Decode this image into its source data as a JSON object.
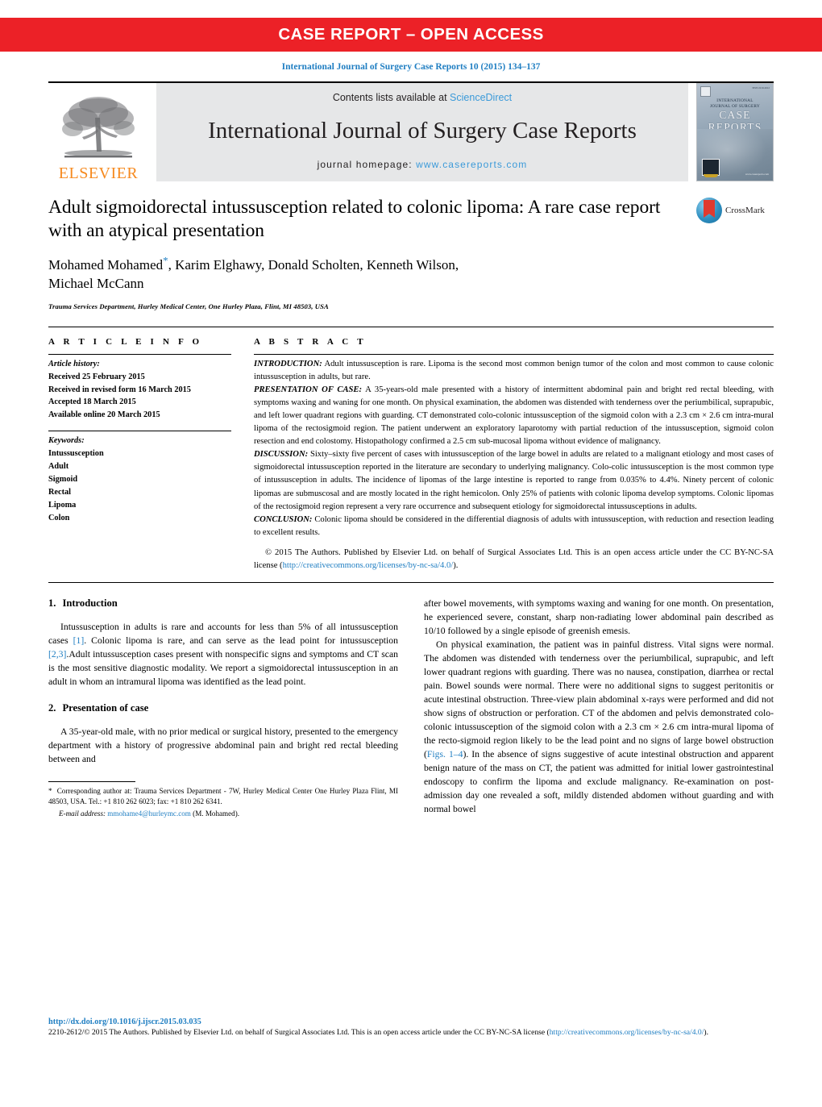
{
  "banner": {
    "text": "CASE REPORT – OPEN ACCESS"
  },
  "citation": "International Journal of Surgery Case Reports 10 (2015) 134–137",
  "masthead": {
    "publisher_logo_name": "elsevier-tree-logo",
    "publisher_wordmark": "ELSEVIER",
    "contents_prefix": "Contents lists available at ",
    "contents_link": "ScienceDirect",
    "journal_title": "International Journal of Surgery Case Reports",
    "homepage_prefix": "journal homepage: ",
    "homepage_url": "www.casereports.com",
    "cover": {
      "line1": "INTERNATIONAL",
      "line2": "JOURNAL OF SURGERY",
      "line3": "CASE",
      "line4": "REPORTS",
      "subtitle": "Advancing research for the better of patients",
      "issn_corner": "ISSN 2210-2612",
      "url": "www.casereports.com"
    }
  },
  "article": {
    "title": "Adult sigmoidorectal intussusception related to colonic lipoma: A rare case report with an atypical presentation",
    "authors": "Mohamed Mohamed, Karim Elghawy, Donald Scholten, Kenneth Wilson, Michael McCann",
    "author_marker": "*",
    "affiliation": "Trauma Services Department, Hurley Medical Center, One Hurley Plaza, Flint, MI 48503, USA",
    "crossmark_label": "CrossMark"
  },
  "article_info": {
    "label": "A R T I C L E   I N F O",
    "history_heading": "Article history:",
    "history": [
      "Received 25 February 2015",
      "Received in revised form 16 March 2015",
      "Accepted 18 March 2015",
      "Available online 20 March 2015"
    ],
    "keywords_heading": "Keywords:",
    "keywords": [
      "Intussusception",
      "Adult",
      "Sigmoid",
      "Rectal",
      "Lipoma",
      "Colon"
    ]
  },
  "abstract": {
    "label": "A B S T R A C T",
    "intro_label": "INTRODUCTION:",
    "intro_text": " Adult intussusception is rare. Lipoma is the second most common benign tumor of the colon and most common to cause colonic intussusception in adults, but rare.",
    "presentation_label": "PRESENTATION OF CASE:",
    "presentation_text": " A 35-years-old male presented with a history of intermittent abdominal pain and bright red rectal bleeding, with symptoms waxing and waning for one month. On physical examination, the abdomen was distended with tenderness over the periumbilical, suprapubic, and left lower quadrant regions with guarding. CT demonstrated colo-colonic intussusception of the sigmoid colon with a 2.3 cm × 2.6 cm intra-mural lipoma of the rectosigmoid region. The patient underwent an exploratory laparotomy with partial reduction of the intussusception, sigmoid colon resection and end colostomy. Histopathology confirmed a 2.5 cm sub-mucosal lipoma without evidence of malignancy.",
    "discussion_label": "DISCUSSION:",
    "discussion_text": " Sixty–sixty five percent of cases with intussusception of the large bowel in adults are related to a malignant etiology and most cases of sigmoidorectal intussusception reported in the literature are secondary to underlying malignancy. Colo-colic intussusception is the most common type of intussusception in adults. The incidence of lipomas of the large intestine is reported to range from 0.035% to 4.4%. Ninety percent of colonic lipomas are submuscosal and are mostly located in the right hemicolon. Only 25% of patients with colonic lipoma develop symptoms. Colonic lipomas of the rectosigmoid region represent a very rare occurrence and subsequent etiology for sigmoidorectal intussusceptions in adults.",
    "conclusion_label": "CONCLUSION:",
    "conclusion_text": " Colonic lipoma should be considered in the differential diagnosis of adults with intussusception, with reduction and resection leading to excellent results.",
    "copyright_text": "© 2015 The Authors. Published by Elsevier Ltd. on behalf of Surgical Associates Ltd. This is an open access article under the CC BY-NC-SA license (",
    "copyright_link": "http://creativecommons.org/licenses/by-nc-sa/4.0/",
    "copyright_tail": ")."
  },
  "body": {
    "section1_num": "1.",
    "section1_title": "Introduction",
    "section1_p1_a": "Intussusception in adults is rare and accounts for less than 5% of all intussusception cases ",
    "section1_ref1": "[1]",
    "section1_p1_b": ". Colonic lipoma is rare, and can serve as the lead point for intussusception ",
    "section1_ref2": "[2,3]",
    "section1_p1_c": ".Adult intussusception cases present with nonspecific signs and symptoms and CT scan is the most sensitive diagnostic modality. We report a sigmoidorectal intussusception in an adult in whom an intramural lipoma was identified as the lead point.",
    "section2_num": "2.",
    "section2_title": "Presentation of case",
    "section2_p1": "A 35-year-old male, with no prior medical or surgical history, presented to the emergency department with a history of progressive abdominal pain and bright red rectal bleeding between and",
    "right_p1": "after bowel movements, with symptoms waxing and waning for one month. On presentation, he experienced severe, constant, sharp non-radiating lower abdominal pain described as 10/10 followed by a single episode of greenish emesis.",
    "right_p2_a": "On physical examination, the patient was in painful distress. Vital signs were normal. The abdomen was distended with tenderness over the periumbilical, suprapubic, and left lower quadrant regions with guarding. There was no nausea, constipation, diarrhea or rectal pain. Bowel sounds were normal. There were no additional signs to suggest peritonitis or acute intestinal obstruction. Three-view plain abdominal x-rays were performed and did not show signs of obstruction or perforation. CT of the abdomen and pelvis demonstrated colo-colonic intussusception of the sigmoid colon with a 2.3 cm × 2.6 cm intra-mural lipoma of the recto-sigmoid region likely to be the lead point and no signs of large bowel obstruction (",
    "right_figs_link": "Figs. 1–4",
    "right_p2_b": "). In the absence of signs suggestive of acute intestinal obstruction and apparent benign nature of the mass on CT, the patient was admitted for initial lower gastrointestinal endoscopy to confirm the lipoma and exclude malignancy. Re-examination on post-admission day one revealed a soft, mildly distended abdomen without guarding and with normal bowel"
  },
  "footnote": {
    "star": "*",
    "corresponding_text": " Corresponding author at: Trauma Services Department - 7W, Hurley Medical Center One Hurley Plaza Flint, MI 48503, USA. Tel.: +1 810 262 6023; fax: +1 810 262 6341.",
    "email_label": "E-mail address:",
    "email": "mmohame4@hurleymc.com",
    "email_owner": "(M. Mohamed)."
  },
  "page_footer": {
    "doi": "http://dx.doi.org/10.1016/j.ijscr.2015.03.035",
    "issn_copyright": "2210-2612/© 2015 The Authors. Published by Elsevier Ltd. on behalf of Surgical Associates Ltd. This is an open access article under the CC BY-NC-SA license (",
    "license_link": "http://creativecommons.org/licenses/by-nc-sa/4.0/",
    "license_tail": ")."
  },
  "colors": {
    "banner_red": "#ec2127",
    "link_blue": "#1f7ec2",
    "sciencedirect_blue": "#3b9ad9",
    "elsevier_orange": "#f68a1f",
    "masthead_grey": "#e6e7e8"
  }
}
